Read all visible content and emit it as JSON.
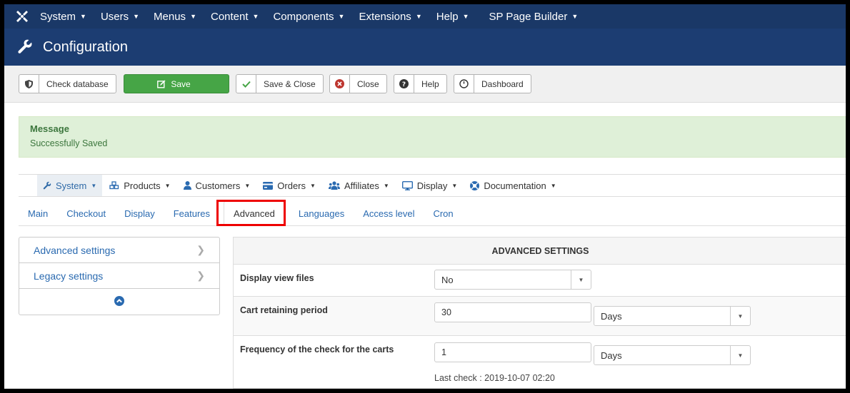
{
  "top_menu": {
    "items": [
      {
        "label": "System"
      },
      {
        "label": "Users"
      },
      {
        "label": "Menus"
      },
      {
        "label": "Content"
      },
      {
        "label": "Components"
      },
      {
        "label": "Extensions"
      },
      {
        "label": "Help"
      },
      {
        "label": "SP Page Builder"
      }
    ]
  },
  "header": {
    "title": "Configuration"
  },
  "toolbar": {
    "check_database": "Check database",
    "save": "Save",
    "save_close": "Save & Close",
    "close": "Close",
    "help": "Help",
    "dashboard": "Dashboard"
  },
  "message": {
    "heading": "Message",
    "text": "Successfully Saved"
  },
  "component_menu": {
    "items": [
      {
        "label": "System",
        "icon": "wrench-icon"
      },
      {
        "label": "Products",
        "icon": "cubes-icon"
      },
      {
        "label": "Customers",
        "icon": "user-icon"
      },
      {
        "label": "Orders",
        "icon": "credit-card-icon"
      },
      {
        "label": "Affiliates",
        "icon": "users-icon"
      },
      {
        "label": "Display",
        "icon": "desktop-icon"
      },
      {
        "label": "Documentation",
        "icon": "life-ring-icon"
      }
    ]
  },
  "tabs": [
    "Main",
    "Checkout",
    "Display",
    "Features",
    "Advanced",
    "Languages",
    "Access level",
    "Cron"
  ],
  "sidebar": {
    "items": [
      {
        "label": "Advanced settings"
      },
      {
        "label": "Legacy settings"
      }
    ]
  },
  "settings": {
    "heading": "ADVANCED SETTINGS",
    "display_view_files": {
      "label": "Display view files",
      "value": "No"
    },
    "cart_retaining": {
      "label": "Cart retaining period",
      "value": "30",
      "unit": "Days"
    },
    "check_frequency": {
      "label": "Frequency of the check for the carts",
      "value": "1",
      "unit": "Days",
      "last_check": "Last check : 2019-10-07 02:20"
    }
  },
  "colors": {
    "topbar": "#1a3867",
    "header": "#1c3d72",
    "save_green": "#46a546",
    "message_bg": "#dff0d8",
    "link_blue": "#2a6ab0",
    "highlight_red": "#e00000"
  }
}
